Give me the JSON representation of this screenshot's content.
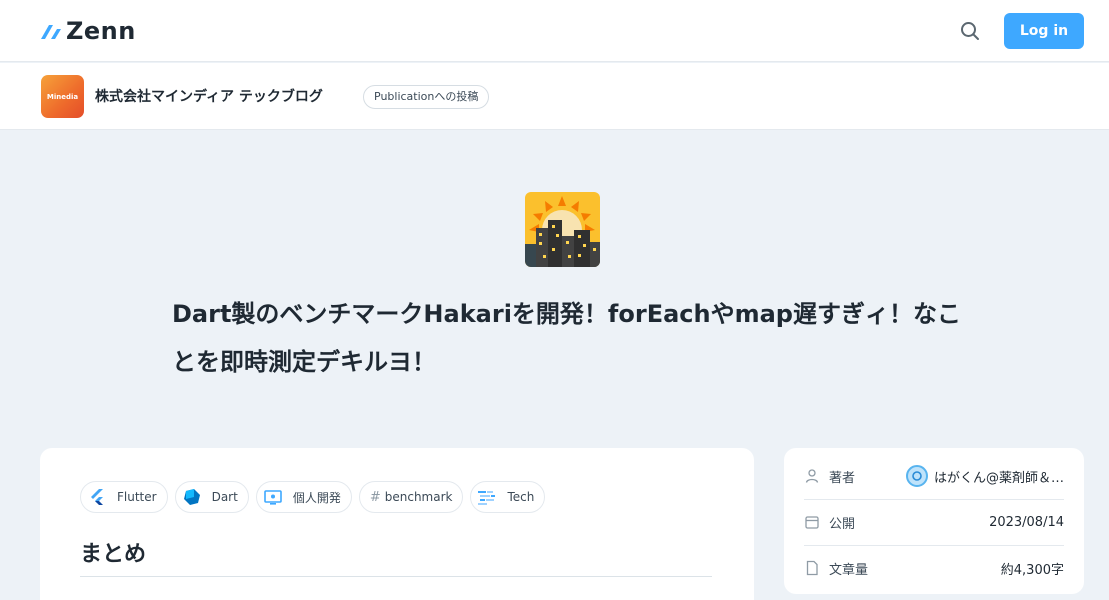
{
  "header": {
    "logo_text": "Zenn",
    "login_label": "Log in"
  },
  "publication": {
    "avatar_text": "Minedia",
    "name": "株式会社マインディア テックブログ",
    "badge": "Publicationへの投稿"
  },
  "article": {
    "title": "Dart製のベンチマークHakariを開発！forEachやmap遅すぎィ！なことを即時測定デキルヨ！",
    "topics": [
      {
        "label": "Flutter",
        "icon": "flutter-icon"
      },
      {
        "label": "Dart",
        "icon": "dart-icon"
      },
      {
        "label": "個人開発",
        "icon": "monitor-icon"
      },
      {
        "label": "benchmark",
        "icon": "hash-icon",
        "prefix": "#"
      },
      {
        "label": "Tech",
        "icon": "tech-icon"
      }
    ],
    "section_heading": "まとめ"
  },
  "info": {
    "author_label": "著者",
    "author_name": "はがくん@薬剤師＆…",
    "published_label": "公開",
    "published_date": "2023/08/14",
    "length_label": "文章量",
    "length_value": "約4,300字"
  },
  "colors": {
    "accent": "#3ea8ff",
    "background": "#edf2f7",
    "text": "#1f2933"
  }
}
